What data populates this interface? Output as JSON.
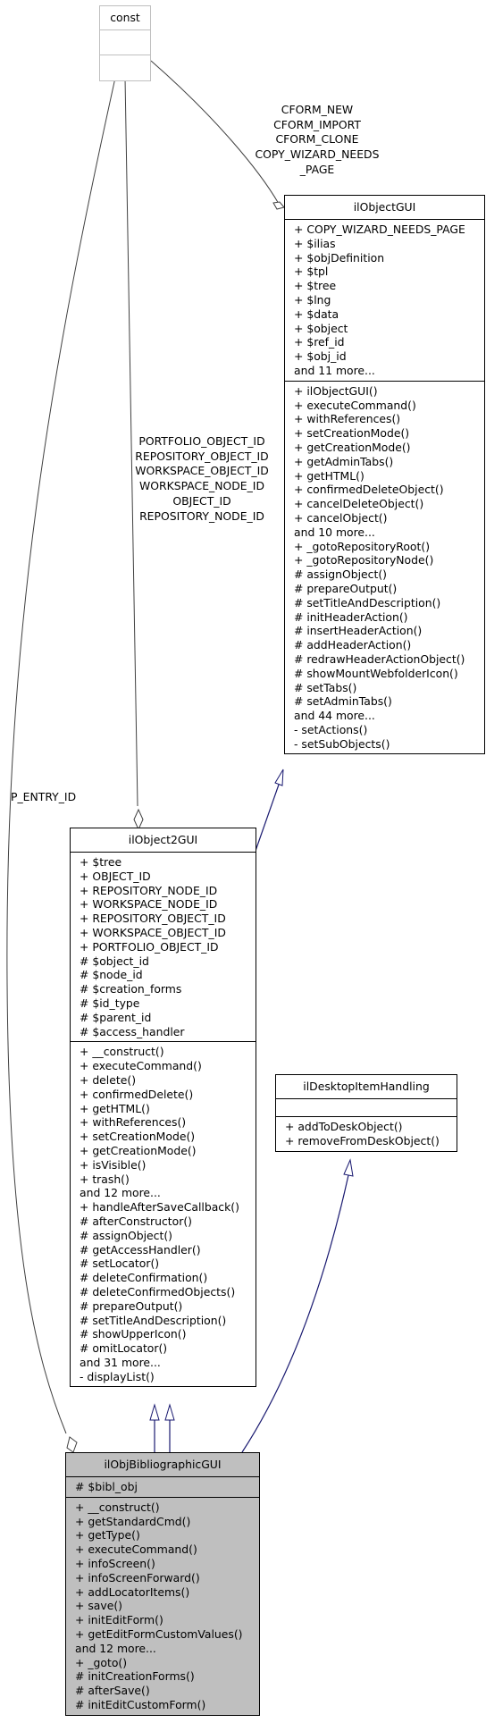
{
  "colors": {
    "inheritance": "#191970",
    "usage": "#404040",
    "focus_fill": "#bfbfbf",
    "undocumented_border": "#bfbfbf"
  },
  "nodes": {
    "const": {
      "name": "const",
      "attributes": [],
      "methods": []
    },
    "ilObjectGUI": {
      "name": "ilObjectGUI",
      "attributes": [
        "+ COPY_WIZARD_NEEDS_PAGE",
        "+ $ilias",
        "+ $objDefinition",
        "+ $tpl",
        "+ $tree",
        "+ $lng",
        "+ $data",
        "+ $object",
        "+ $ref_id",
        "+ $obj_id",
        "and 11 more..."
      ],
      "methods": [
        "+ ilObjectGUI()",
        "+ executeCommand()",
        "+ withReferences()",
        "+ setCreationMode()",
        "+ getCreationMode()",
        "+ getAdminTabs()",
        "+ getHTML()",
        "+ confirmedDeleteObject()",
        "+ cancelDeleteObject()",
        "+ cancelObject()",
        "and 10 more...",
        "+ _gotoRepositoryRoot()",
        "+ _gotoRepositoryNode()",
        "# assignObject()",
        "# prepareOutput()",
        "# setTitleAndDescription()",
        "# initHeaderAction()",
        "# insertHeaderAction()",
        "# addHeaderAction()",
        "# redrawHeaderActionObject()",
        "# showMountWebfolderIcon()",
        "# setTabs()",
        "# setAdminTabs()",
        "and 44 more...",
        "- setActions()",
        "- setSubObjects()"
      ]
    },
    "ilObject2GUI": {
      "name": "ilObject2GUI",
      "attributes": [
        "+ $tree",
        "+ OBJECT_ID",
        "+ REPOSITORY_NODE_ID",
        "+ WORKSPACE_NODE_ID",
        "+ REPOSITORY_OBJECT_ID",
        "+ WORKSPACE_OBJECT_ID",
        "+ PORTFOLIO_OBJECT_ID",
        "# $object_id",
        "# $node_id",
        "# $creation_forms",
        "# $id_type",
        "# $parent_id",
        "# $access_handler"
      ],
      "methods": [
        "+ __construct()",
        "+ executeCommand()",
        "+ delete()",
        "+ confirmedDelete()",
        "+ getHTML()",
        "+ withReferences()",
        "+ setCreationMode()",
        "+ getCreationMode()",
        "+ isVisible()",
        "+ trash()",
        "and 12 more...",
        "+ handleAfterSaveCallback()",
        "# afterConstructor()",
        "# assignObject()",
        "# getAccessHandler()",
        "# setLocator()",
        "# deleteConfirmation()",
        "# deleteConfirmedObjects()",
        "# prepareOutput()",
        "# setTitleAndDescription()",
        "# showUpperIcon()",
        "# omitLocator()",
        "and 31 more...",
        "- displayList()"
      ]
    },
    "ilDesktopItemHandling": {
      "name": "ilDesktopItemHandling",
      "attributes": [],
      "methods": [
        "+ addToDeskObject()",
        "+ removeFromDeskObject()"
      ]
    },
    "ilObjBibliographicGUI": {
      "name": "ilObjBibliographicGUI",
      "attributes": [
        "# $bibl_obj"
      ],
      "methods": [
        "+ __construct()",
        "+ getStandardCmd()",
        "+ getType()",
        "+ executeCommand()",
        "+ infoScreen()",
        "+ infoScreenForward()",
        "+ addLocatorItems()",
        "+ save()",
        "+ initEditForm()",
        "+ getEditFormCustomValues()",
        "and 12 more...",
        "+ _goto()",
        "# initCreationForms()",
        "# afterSave()",
        "# initEditCustomForm()"
      ]
    }
  },
  "edges": {
    "const_to_ilObjectGUI": {
      "labels": [
        "CFORM_NEW",
        "CFORM_IMPORT",
        "CFORM_CLONE",
        "COPY_WIZARD_NEEDS",
        "_PAGE"
      ]
    },
    "const_to_ilObject2GUI": {
      "labels": [
        "PORTFOLIO_OBJECT_ID",
        "REPOSITORY_OBJECT_ID",
        "WORKSPACE_OBJECT_ID",
        "WORKSPACE_NODE_ID",
        "OBJECT_ID",
        "REPOSITORY_NODE_ID"
      ]
    },
    "const_to_ilObjBibliographicGUI": {
      "labels": [
        "P_ENTRY_ID"
      ]
    }
  }
}
